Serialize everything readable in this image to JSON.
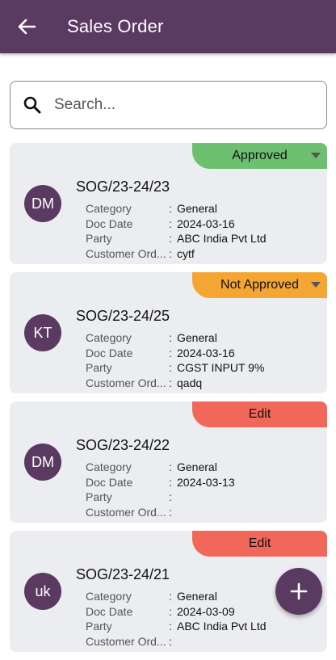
{
  "appbar": {
    "title": "Sales Order"
  },
  "search": {
    "placeholder": "Search..."
  },
  "colors": {
    "primary": "#5b3a62",
    "approved": "#6cc070",
    "not_approved": "#f5a531",
    "edit": "#f1675a",
    "card_bg": "#ebedf0"
  },
  "labels": {
    "category": "Category",
    "doc_date": "Doc Date",
    "party": "Party",
    "customer_order": "Customer Ord...",
    "sep": ":"
  },
  "orders": [
    {
      "initials": "DM",
      "number": "SOG/23-24/23",
      "status": "Approved",
      "status_color": "#6cc070",
      "dropdown": true,
      "category": "General",
      "doc_date": "2024-03-16",
      "party": "ABC India Pvt Ltd",
      "customer_order": "cytf"
    },
    {
      "initials": "KT",
      "number": "SOG/23-24/25",
      "status": "Not Approved",
      "status_color": "#f5a531",
      "dropdown": true,
      "category": "General",
      "doc_date": "2024-03-16",
      "party": "CGST INPUT 9%",
      "customer_order": "qadq"
    },
    {
      "initials": "DM",
      "number": "SOG/23-24/22",
      "status": "Edit",
      "status_color": "#f1675a",
      "dropdown": false,
      "category": "General",
      "doc_date": "2024-03-13",
      "party": "",
      "customer_order": ""
    },
    {
      "initials": "uk",
      "number": "SOG/23-24/21",
      "status": "Edit",
      "status_color": "#f1675a",
      "dropdown": false,
      "category": "General",
      "doc_date": "2024-03-09",
      "party": "ABC India Pvt Ltd",
      "customer_order": ""
    }
  ],
  "fab": {
    "icon": "plus-icon"
  }
}
